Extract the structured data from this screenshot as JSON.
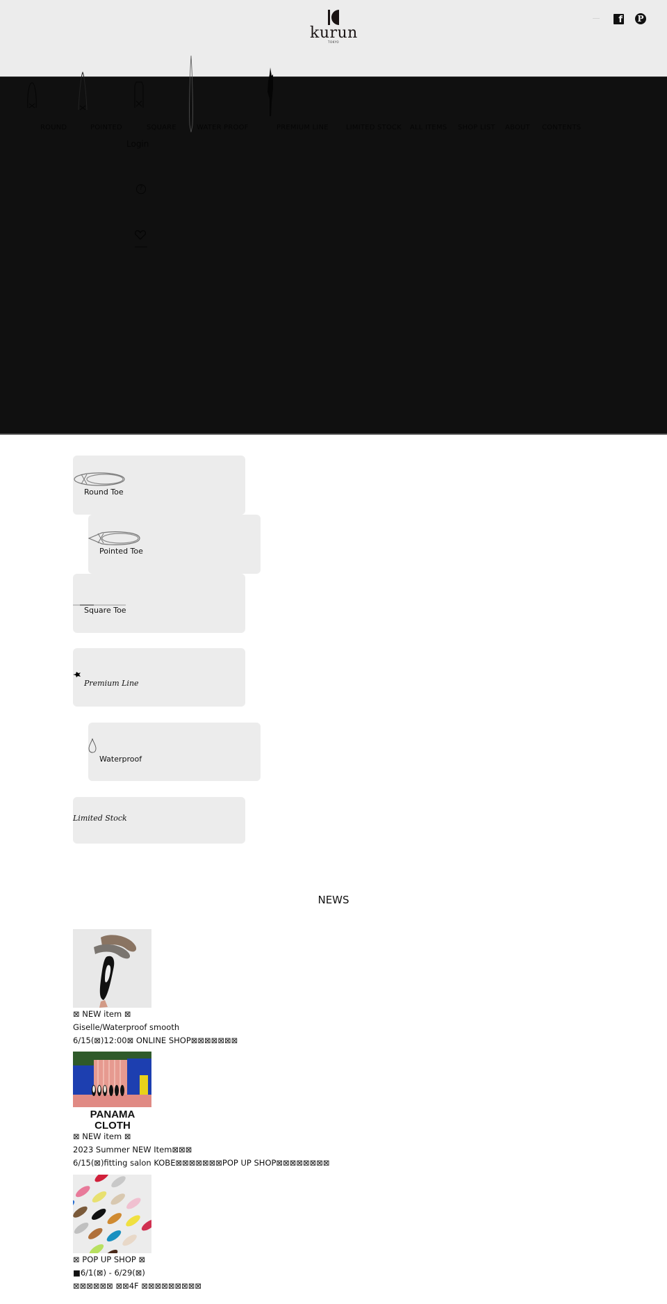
{
  "header": {
    "logo_word": "kurun",
    "logo_sub": "TOKYO",
    "social": [
      {
        "name": "facebook",
        "icon": "facebook-icon",
        "glyph": "f"
      },
      {
        "name": "pinterest",
        "icon": "pinterest-icon",
        "glyph": "P"
      }
    ]
  },
  "nav": {
    "items": [
      {
        "label": "ROUND",
        "icon": "round-toe-icon"
      },
      {
        "label": "POINTED",
        "icon": "pointed-toe-icon"
      },
      {
        "label": "SQUARE",
        "icon": "square-toe-icon"
      },
      {
        "label": "WATER PROOF",
        "icon": "waterproof-icon"
      },
      {
        "label": "PREMIUM LINE",
        "icon": "premium-line-icon"
      },
      {
        "label": "LIMITED STOCK"
      },
      {
        "label": "ALL ITEMS"
      },
      {
        "label": "SHOP LIST"
      },
      {
        "label": "ABOUT"
      },
      {
        "label": "CONTENTS"
      }
    ],
    "login_label": "Login",
    "help_glyph": "?"
  },
  "categories": [
    {
      "label": "Round Toe",
      "icon": "round-toe-shoe-icon"
    },
    {
      "label": "Pointed Toe",
      "icon": "pointed-toe-shoe-icon"
    },
    {
      "label": "Square Toe",
      "icon": "square-toe-shoe-icon"
    },
    {
      "label": "Premium Line",
      "icon": "premium-line-icon"
    },
    {
      "label": "Waterproof",
      "icon": "water-drop-icon"
    },
    {
      "label": "Limited Stock"
    }
  ],
  "news": {
    "title": "NEWS",
    "items": [
      {
        "image": "shoes-held-in-hand-photo",
        "lines": [
          "⊠ NEW item ⊠",
          "Giselle/Waterproof smooth",
          "6/15(⊠)12:00⊠ ONLINE SHOP⊠⊠⊠⊠⊠⊠⊠"
        ]
      },
      {
        "image": "panama-cloth-photo",
        "image_caption": [
          "PANAMA",
          "CLOTH"
        ],
        "lines": [
          "⊠ NEW item ⊠",
          "2023 Summer NEW Item⊠⊠⊠",
          "6/15(⊠)fitting salon KOBE⊠⊠⊠⊠⊠⊠⊠POP UP SHOP⊠⊠⊠⊠⊠⊠⊠⊠"
        ]
      },
      {
        "image": "colorful-flats-photo",
        "lines": [
          "⊠ POP UP SHOP ⊠",
          "■6/1(⊠) - 6/29(⊠)",
          "⊠⊠⊠⊠⊠⊠ ⊠⊠4F ⊠⊠⊠⊠⊠⊠⊠⊠⊠"
        ]
      }
    ]
  }
}
